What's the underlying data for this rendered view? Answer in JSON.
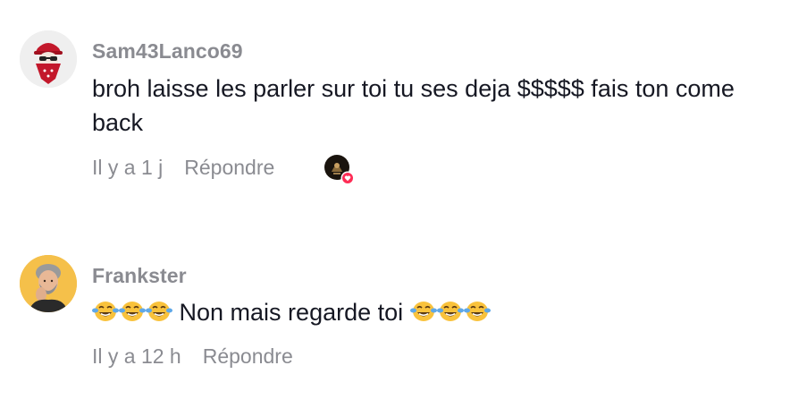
{
  "comments": [
    {
      "username": "Sam43Lanco69",
      "text": "broh laisse les parler sur toi tu ses deja $$$$$ fais ton come back",
      "time": "Il y a 1 j",
      "reply_label": "Répondre",
      "liked_by_creator": true,
      "avatar_icon": "bandana-skull-avatar",
      "accent": "#c3182b"
    },
    {
      "username": "Frankster",
      "text_before_emoji": "",
      "text": "Non mais regarde toi",
      "time": "Il y a 12 h",
      "reply_label": "Répondre",
      "emoji_icon": "face-with-tears-of-joy-icon",
      "emoji_count_before": 3,
      "emoji_count_after": 3,
      "avatar_icon": "portrait-avatar",
      "accent": "#f5c04a"
    }
  ],
  "colors": {
    "text": "#161823",
    "muted": "#8a8b91",
    "heart": "#fe2c55"
  }
}
